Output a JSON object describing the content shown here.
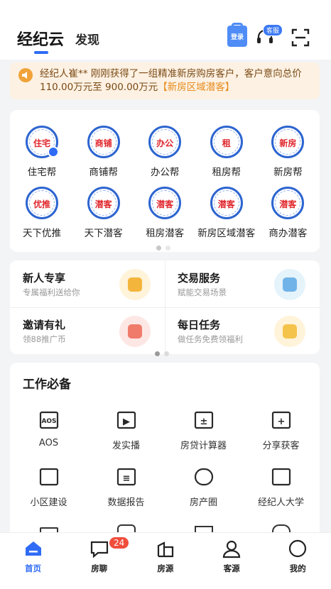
{
  "header": {
    "tab_main": "经纪云",
    "tab_sub": "发现",
    "login_label": "登录",
    "service_badge": "客服"
  },
  "notice": {
    "text": "经纪人崔** 刚刚获得了一组精准新房购房客户，客户意向总价 110.00万元至 900.00万元",
    "highlight": "【新房区域潜客】"
  },
  "apps": [
    {
      "logo": "住宅",
      "label": "住宅帮"
    },
    {
      "logo": "商铺",
      "label": "商铺帮"
    },
    {
      "logo": "办公",
      "label": "办公帮"
    },
    {
      "logo": "租",
      "label": "租房帮"
    },
    {
      "logo": "新房",
      "label": "新房帮"
    },
    {
      "logo": "优推",
      "label": "天下优推"
    },
    {
      "logo": "潜客",
      "label": "天下潜客"
    },
    {
      "logo": "潜客",
      "label": "租房潜客"
    },
    {
      "logo": "潜客",
      "label": "新房区域潜客"
    },
    {
      "logo": "潜客",
      "label": "商办潜客"
    }
  ],
  "promos": [
    {
      "title": "新人专享",
      "sub": "专属福利送给你",
      "icon": "gift-coin-icon"
    },
    {
      "title": "交易服务",
      "sub": "赋能交易场景",
      "icon": "handshake-icon"
    },
    {
      "title": "邀请有礼",
      "sub": "领88推广币",
      "icon": "gift-box-icon"
    },
    {
      "title": "每日任务",
      "sub": "做任务免费领福利",
      "icon": "calendar-check-icon"
    }
  ],
  "tools": {
    "title": "工作必备",
    "items": [
      {
        "label": "AOS",
        "icon": "aos-icon",
        "glyph": "AOS"
      },
      {
        "label": "发实播",
        "icon": "live-tv-icon",
        "glyph": "▶"
      },
      {
        "label": "房贷计算器",
        "icon": "calculator-icon",
        "glyph": "±"
      },
      {
        "label": "分享获客",
        "icon": "share-user-icon",
        "glyph": "+"
      },
      {
        "label": "小区建设",
        "icon": "building-icon",
        "glyph": ""
      },
      {
        "label": "数据报告",
        "icon": "report-icon",
        "glyph": "≡"
      },
      {
        "label": "房产圈",
        "icon": "planet-icon",
        "glyph": ""
      },
      {
        "label": "经纪人大学",
        "icon": "book-icon",
        "glyph": ""
      }
    ]
  },
  "nav": {
    "items": [
      {
        "label": "首页",
        "icon": "home-icon"
      },
      {
        "label": "房聊",
        "icon": "chat-icon"
      },
      {
        "label": "房源",
        "icon": "house-icon"
      },
      {
        "label": "客源",
        "icon": "person-icon"
      },
      {
        "label": "我的",
        "icon": "profile-icon"
      }
    ],
    "chat_badge": "24"
  },
  "colors": {
    "accent": "#2f6bf5",
    "notice_bg": "#fdf1e3",
    "notice_text": "#7a4a14",
    "badge_red": "#f04d3b"
  }
}
